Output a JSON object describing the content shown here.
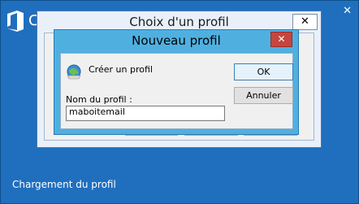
{
  "splash": {
    "brand_fragment": "C",
    "close_glyph": "✕",
    "status": "Chargement du profil"
  },
  "back_dialog": {
    "title": "Choix d'un profil",
    "close_glyph": "✕"
  },
  "front_dialog": {
    "title": "Nouveau profil",
    "close_glyph": "✕",
    "create_label": "Créer un profil",
    "name_label": "Nom du profil :",
    "name_value": "maboitemail",
    "ok_label": "OK",
    "cancel_label": "Annuler"
  },
  "colors": {
    "splash_bg": "#1f6fbe",
    "dialog_title_bg": "#4fb0e0",
    "close_red": "#c7453f"
  }
}
